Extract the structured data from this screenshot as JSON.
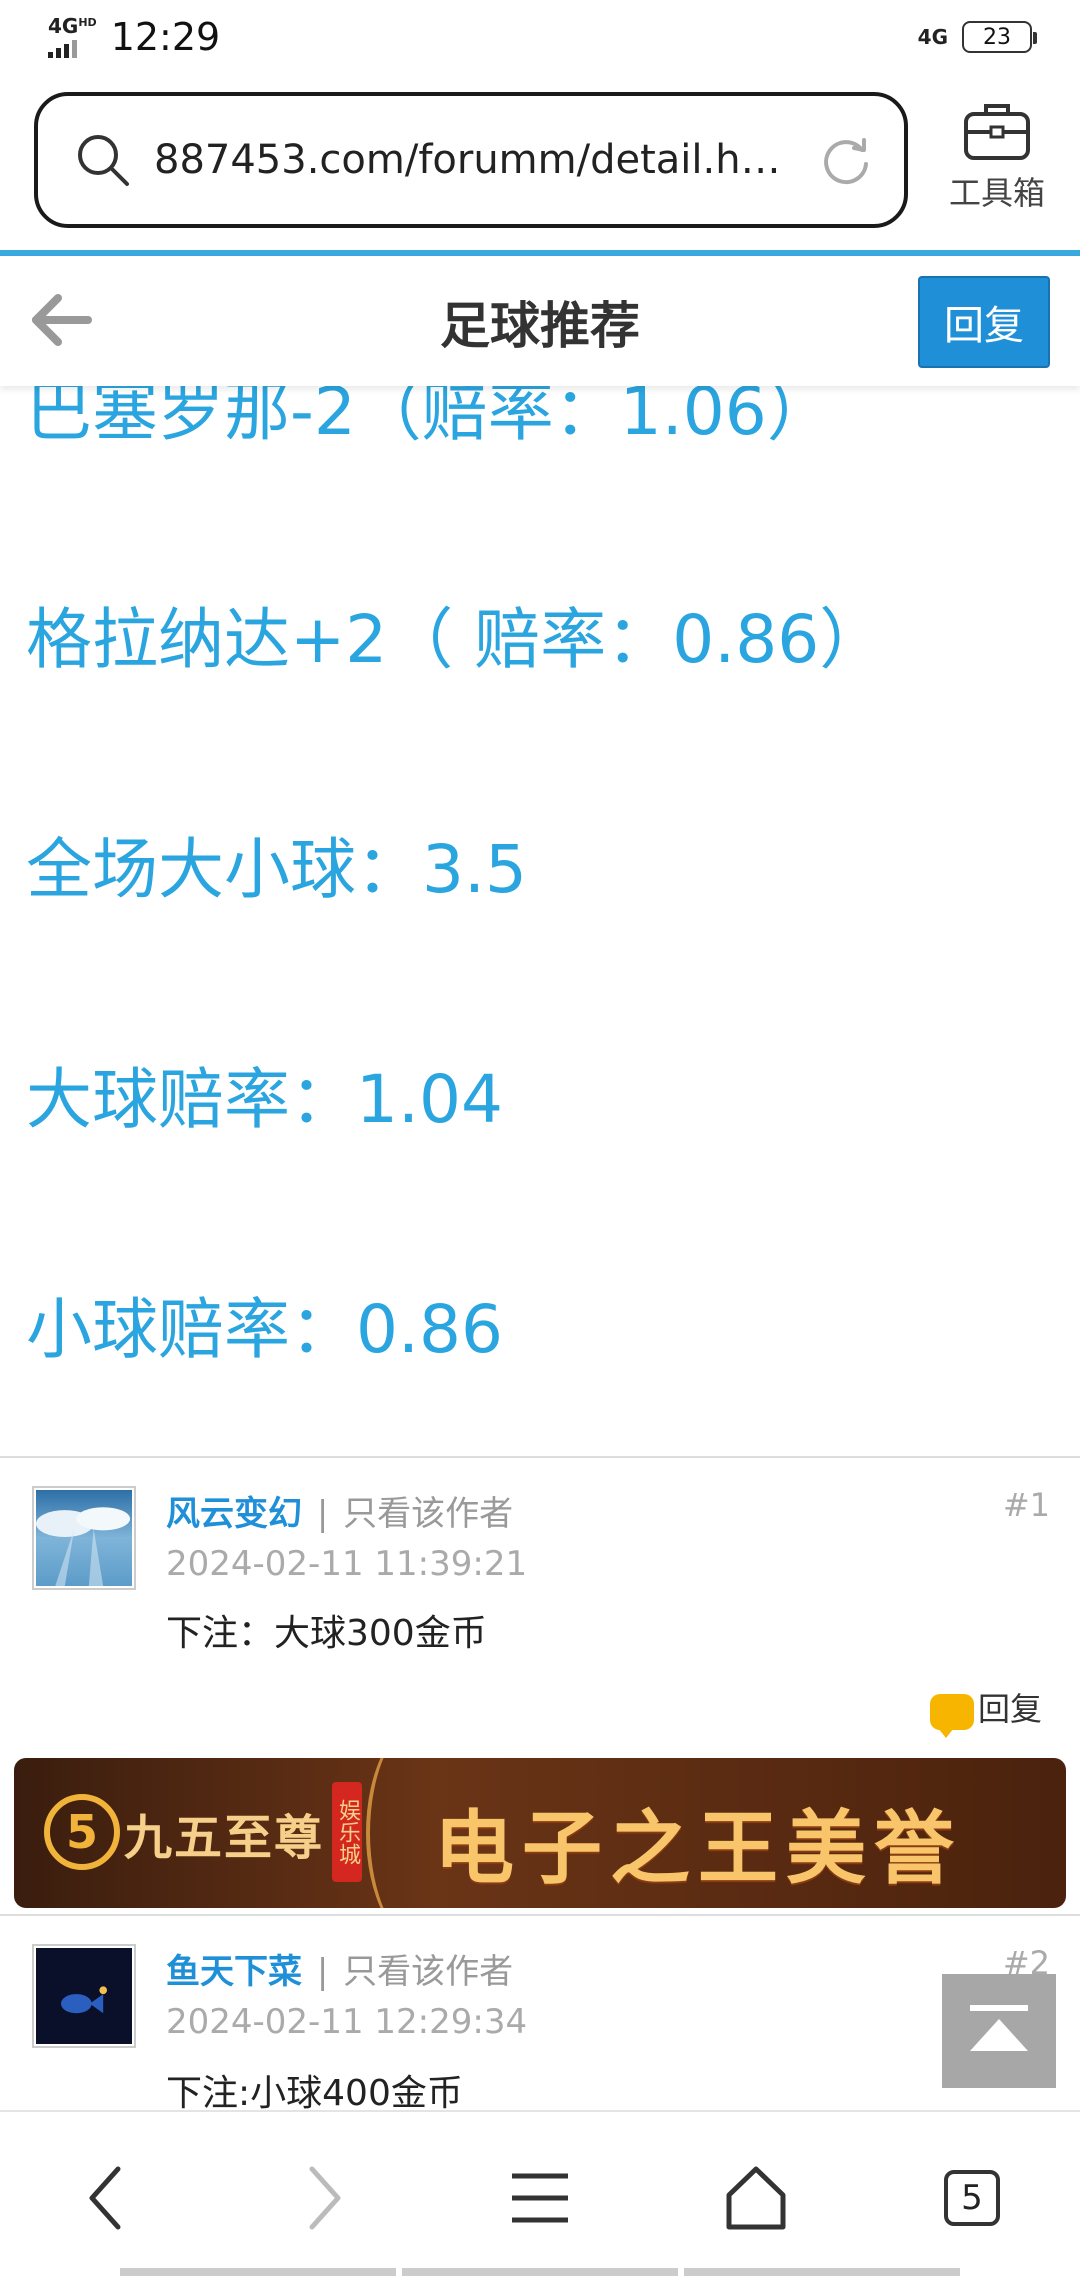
{
  "status_bar": {
    "network": "4G",
    "network_sup": "HD",
    "time": "12:29",
    "network_right": "4G",
    "battery": "23"
  },
  "browser": {
    "url": "887453.com/forumm/detail.h…",
    "toolbox_label": "工具箱"
  },
  "header": {
    "title": "足球推荐",
    "reply_label": "回复"
  },
  "post": {
    "lines": [
      "巴塞罗那-2（赔率：1.06）",
      "格拉纳达+2（ 赔率：0.86）",
      "全场大小球：3.5",
      "大球赔率：1.04",
      "小球赔率：0.86"
    ]
  },
  "comments": [
    {
      "author": "风云变幻",
      "sep": "|",
      "author_only": "只看该作者",
      "date": "2024-02-11 11:39:21",
      "body": "下注：大球300金币",
      "floor": "#1",
      "reply": "回复"
    },
    {
      "author": "鱼天下菜",
      "sep": "|",
      "author_only": "只看该作者",
      "date": "2024-02-11 12:29:34",
      "body": "下注:小球400金币",
      "floor": "#2"
    }
  ],
  "banner": {
    "logo_char": "5",
    "brand": "九五至尊",
    "tag": "娱乐城",
    "slogan": "电子之王美誉"
  },
  "bottom_nav": {
    "tabs_count": "5"
  },
  "colors": {
    "accent": "#1f8fd7",
    "post_text": "#2aa5df"
  }
}
